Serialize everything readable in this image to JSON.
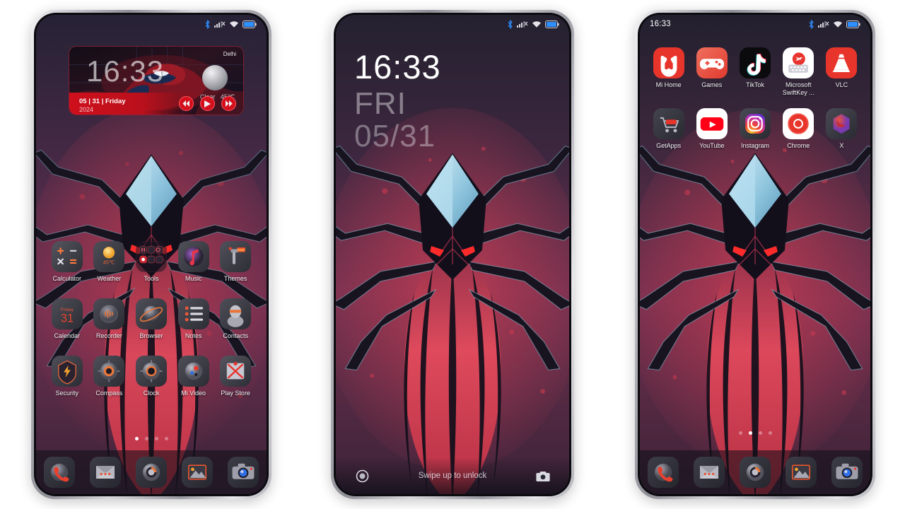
{
  "wallpaper": {
    "name": "dark-spider-wallpaper",
    "colors": {
      "bg_top": "#262235",
      "bg_mid": "#6b2f4d",
      "body_red": "#d83b4e",
      "body_deep": "#a12740",
      "leg_dark": "#16131f",
      "crystal_blue": "#9fd2e8",
      "eye_red": "#ff2b2b",
      "accent_red": "#cf0f1c"
    }
  },
  "phones": [
    {
      "id": "phone-1",
      "type": "home-screen",
      "statusbar": {
        "clock": "",
        "icons": [
          "bluetooth-icon",
          "signal-no-sim-icon",
          "wifi-icon",
          "battery-icon"
        ]
      },
      "widget": {
        "name": "spiderman-clock-weather-widget",
        "city": "Delhi",
        "time": "16:33",
        "condition": "Clear",
        "temperature": "45℃",
        "date": "05 | 31 | Friday",
        "year": "2024",
        "controls": [
          {
            "name": "previous-track-button",
            "icon": "rewind-icon"
          },
          {
            "name": "play-button",
            "icon": "play-icon"
          },
          {
            "name": "next-track-button",
            "icon": "fast-forward-icon"
          }
        ]
      },
      "apps": [
        {
          "label": "Calculator",
          "icon": "calculator-icon"
        },
        {
          "label": "Weather",
          "icon": "weather-icon",
          "badge": "45℃"
        },
        {
          "label": "Tools",
          "icon": "tools-folder-icon"
        },
        {
          "label": "Music",
          "icon": "music-icon"
        },
        {
          "label": "Themes",
          "icon": "themes-icon"
        },
        {
          "label": "Calendar",
          "icon": "calendar-icon",
          "day": "31",
          "weekday": "Friday"
        },
        {
          "label": "Recorder",
          "icon": "recorder-icon"
        },
        {
          "label": "Browser",
          "icon": "browser-icon"
        },
        {
          "label": "Notes",
          "icon": "notes-icon"
        },
        {
          "label": "Contacts",
          "icon": "contacts-icon"
        },
        {
          "label": "Security",
          "icon": "security-icon"
        },
        {
          "label": "Compass",
          "icon": "compass-icon"
        },
        {
          "label": "Clock",
          "icon": "clock-icon"
        },
        {
          "label": "Mi Video",
          "icon": "mi-video-icon"
        },
        {
          "label": "Play Store",
          "icon": "play-store-icon"
        }
      ],
      "pages": {
        "count": 4,
        "active": 0
      },
      "dock": [
        {
          "name": "phone-dock-icon",
          "icon": "phone-icon"
        },
        {
          "name": "messages-dock-icon",
          "icon": "messages-icon"
        },
        {
          "name": "settings-dock-icon",
          "icon": "settings-icon"
        },
        {
          "name": "gallery-dock-icon",
          "icon": "gallery-icon"
        },
        {
          "name": "camera-dock-icon",
          "icon": "camera-icon"
        }
      ]
    },
    {
      "id": "phone-2",
      "type": "lock-screen",
      "statusbar": {
        "clock": "",
        "icons": [
          "bluetooth-icon",
          "signal-no-sim-icon",
          "wifi-icon",
          "battery-icon"
        ]
      },
      "lockscreen": {
        "time": "16:33",
        "weekday": "FRI",
        "date": "05/31",
        "hint": "Swipe up to unlock",
        "left_shortcut": "flashlight-icon",
        "right_shortcut": "camera-icon"
      }
    },
    {
      "id": "phone-3",
      "type": "home-screen",
      "statusbar": {
        "clock": "16:33",
        "icons": [
          "bluetooth-icon",
          "signal-no-sim-icon",
          "wifi-icon",
          "battery-icon"
        ]
      },
      "apps": [
        {
          "label": "Mi Home",
          "icon": "mi-home-icon"
        },
        {
          "label": "Games",
          "icon": "games-icon"
        },
        {
          "label": "TikTok",
          "icon": "tiktok-icon"
        },
        {
          "label": "Microsoft\nSwiftKey ...",
          "icon": "swiftkey-icon"
        },
        {
          "label": "VLC",
          "icon": "vlc-icon"
        },
        {
          "label": "GetApps",
          "icon": "getapps-icon"
        },
        {
          "label": "YouTube",
          "icon": "youtube-icon"
        },
        {
          "label": "Instagram",
          "icon": "instagram-icon"
        },
        {
          "label": "Chrome",
          "icon": "chrome-icon"
        },
        {
          "label": "X",
          "icon": "x-twitter-icon"
        }
      ],
      "pages": {
        "count": 4,
        "active": 1
      },
      "dock": [
        {
          "name": "phone-dock-icon",
          "icon": "phone-icon"
        },
        {
          "name": "messages-dock-icon",
          "icon": "messages-icon"
        },
        {
          "name": "settings-dock-icon",
          "icon": "settings-icon"
        },
        {
          "name": "gallery-dock-icon",
          "icon": "gallery-icon"
        },
        {
          "name": "camera-dock-icon",
          "icon": "camera-icon"
        }
      ]
    }
  ]
}
